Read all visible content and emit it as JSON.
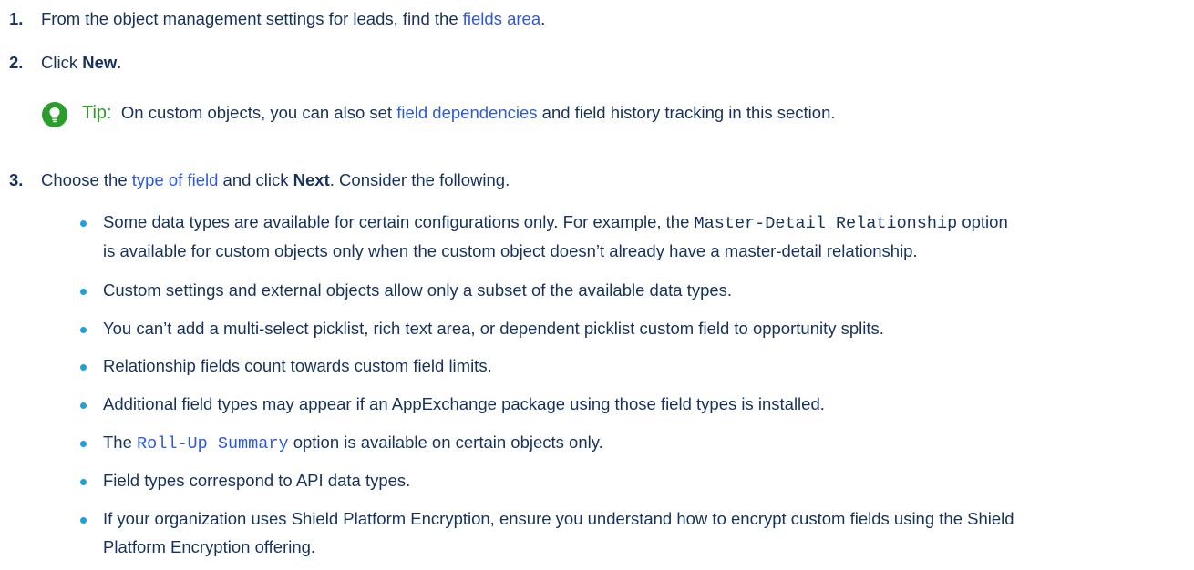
{
  "steps": [
    {
      "number": "1.",
      "before": "From the object management settings for leads, find the ",
      "link": "fields area",
      "after": "."
    },
    {
      "number": "2.",
      "before": "Click ",
      "bold": "New",
      "after": "."
    },
    {
      "number": "3.",
      "before": "Choose the ",
      "link": "type of field",
      "middle": " and click ",
      "bold": "Next",
      "after": ". Consider the following."
    }
  ],
  "tip": {
    "label": "Tip:",
    "before": "On custom objects, you can also set ",
    "link": "field dependencies",
    "after": " and field history tracking in this section."
  },
  "bullets": {
    "b1": {
      "before": "Some data types are available for certain configurations only. For example, the ",
      "code": "Master-Detail Relationship",
      "after": " option",
      "line2": "is available for custom objects only when the custom object doesn’t already have a master-detail relationship."
    },
    "b2": {
      "text": "Custom settings and external objects allow only a subset of the available data types."
    },
    "b3": {
      "text": "You can’t add a multi-select picklist, rich text area, or dependent picklist custom field to opportunity splits."
    },
    "b4": {
      "text": "Relationship fields count towards custom field limits."
    },
    "b5": {
      "text": "Additional field types may appear if an AppExchange package using those field types is installed."
    },
    "b6": {
      "before": "The ",
      "code": "Roll-Up Summary",
      "after": " option is available on certain objects only."
    },
    "b7": {
      "text": "Field types correspond to API data types."
    },
    "b8": {
      "line1": "If your organization uses Shield Platform Encryption, ensure you understand how to encrypt custom fields using the Shield",
      "line2": "Platform Encryption offering."
    }
  },
  "colors": {
    "text": "#16325c",
    "link": "#2e59d9",
    "tip": "#2a9d2a",
    "bullet": "#1ea0df"
  }
}
